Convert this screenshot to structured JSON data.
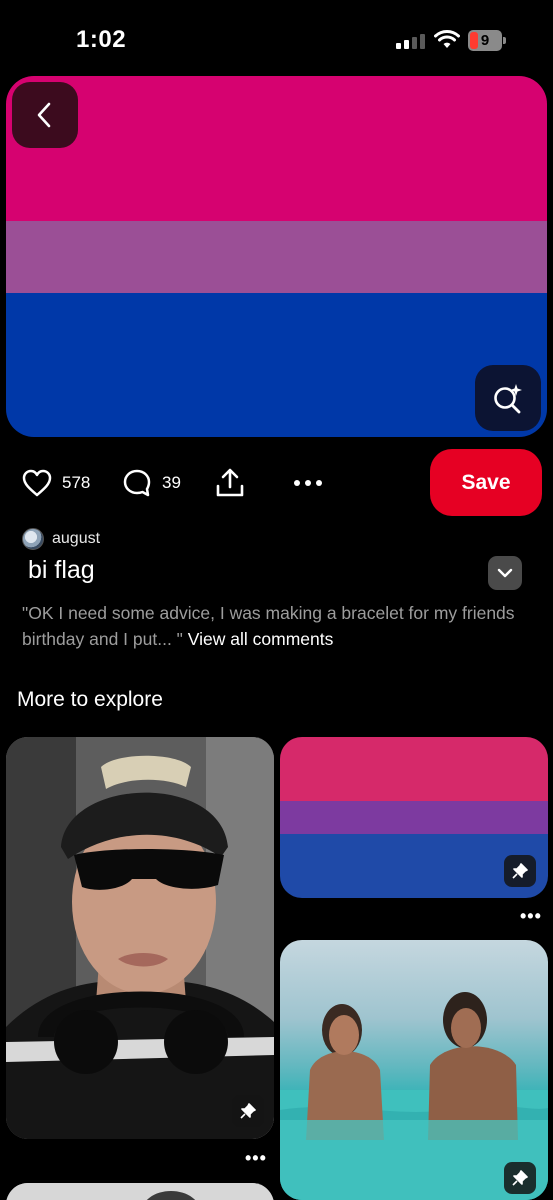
{
  "status_bar": {
    "time": "1:02",
    "battery": "9"
  },
  "pin": {
    "flag_colors": [
      "#d60270",
      "#9b4f96",
      "#0038a8"
    ],
    "likes": "578",
    "comments": "39",
    "save_label": "Save",
    "author": "august",
    "title": "bi flag",
    "comment_preview": "\"OK I need some advice, I was making a bracelet for my friends birthday and I put... \"",
    "view_all_label": "View all comments"
  },
  "explore": {
    "title": "More to explore",
    "cards": [
      {
        "name": "portrait"
      },
      {
        "name": "bi-flag",
        "colors": [
          "#d6296a",
          "#7d3aa0",
          "#1f4aa8"
        ]
      },
      {
        "name": "sea-photo"
      }
    ]
  }
}
